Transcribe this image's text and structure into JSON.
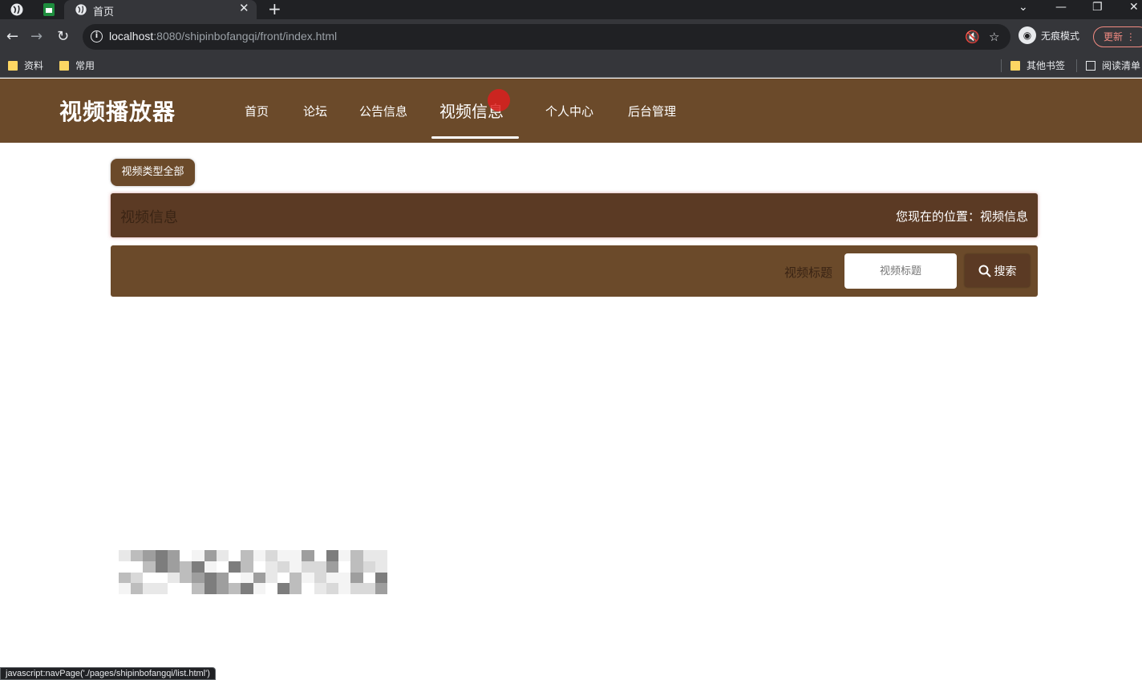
{
  "browser": {
    "tab_title": "首页",
    "url_host": "localhost",
    "url_path": ":8080/shipinbofangqi/front/index.html",
    "incognito_label": "无痕模式",
    "update_label": "更新",
    "bookmarks": [
      "资料",
      "常用"
    ],
    "bookmarks_right": [
      "其他书签",
      "阅读清单"
    ],
    "status_text": "javascript:navPage('./pages/shipinbofangqi/list.html')"
  },
  "site": {
    "logo": "视频播放器",
    "nav": [
      {
        "label": "首页"
      },
      {
        "label": "论坛"
      },
      {
        "label": "公告信息"
      },
      {
        "label": "视频信息",
        "active": true
      },
      {
        "label": "个人中心"
      },
      {
        "label": "后台管理"
      }
    ]
  },
  "content": {
    "type_chip": "视频类型全部",
    "crumb_title": "视频信息",
    "crumb_position": "您现在的位置：视频信息",
    "search_label": "视频标题",
    "search_placeholder": "视频标题",
    "search_button": "搜索"
  },
  "colors": {
    "header_bg": "#6b4a2a",
    "crumb_bg": "#5b3a24",
    "accent_red": "#dc1e1e"
  }
}
